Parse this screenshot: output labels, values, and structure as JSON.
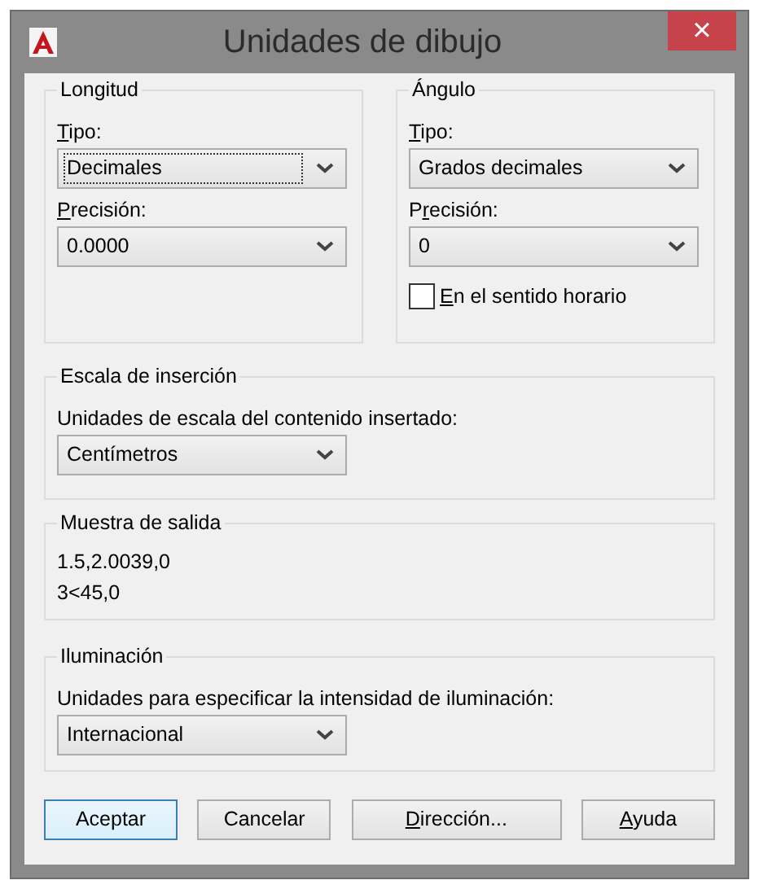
{
  "window": {
    "title": "Unidades de dibujo",
    "close": "×"
  },
  "length": {
    "title": "Longitud",
    "type_label": {
      "key": "T",
      "after": "ipo:"
    },
    "type_value": "Decimales",
    "type_focused": true,
    "precision_label": {
      "key": "P",
      "after": "recisión:"
    },
    "precision_value": "0.0000"
  },
  "angle": {
    "title": "Ángulo",
    "type_label": {
      "key": "T",
      "after": "ipo:"
    },
    "type_value": "Grados decimales",
    "precision_label": {
      "before": "P",
      "key": "r",
      "after": "ecisión:"
    },
    "precision_value": "0",
    "clockwise": {
      "label": {
        "key": "E",
        "after": "n el sentido horario"
      },
      "checked": false
    }
  },
  "insertion_scale": {
    "title": "Escala de inserción",
    "label": "Unidades de escala del contenido insertado:",
    "value": "Centímetros"
  },
  "sample_output": {
    "title": "Muestra de salida",
    "lines": [
      "1.5,2.0039,0",
      "3<45,0"
    ]
  },
  "lighting": {
    "title": "Iluminación",
    "label": "Unidades para especificar la intensidad de iluminación:",
    "value": "Internacional"
  },
  "buttons": [
    {
      "label": {
        "after": "Aceptar"
      },
      "default": true
    },
    {
      "label": {
        "after": "Cancelar"
      },
      "default": false
    },
    {
      "label": {
        "key": "D",
        "after": "irección..."
      },
      "default": false
    },
    {
      "label": {
        "key": "A",
        "after": "yuda"
      },
      "default": false
    }
  ]
}
